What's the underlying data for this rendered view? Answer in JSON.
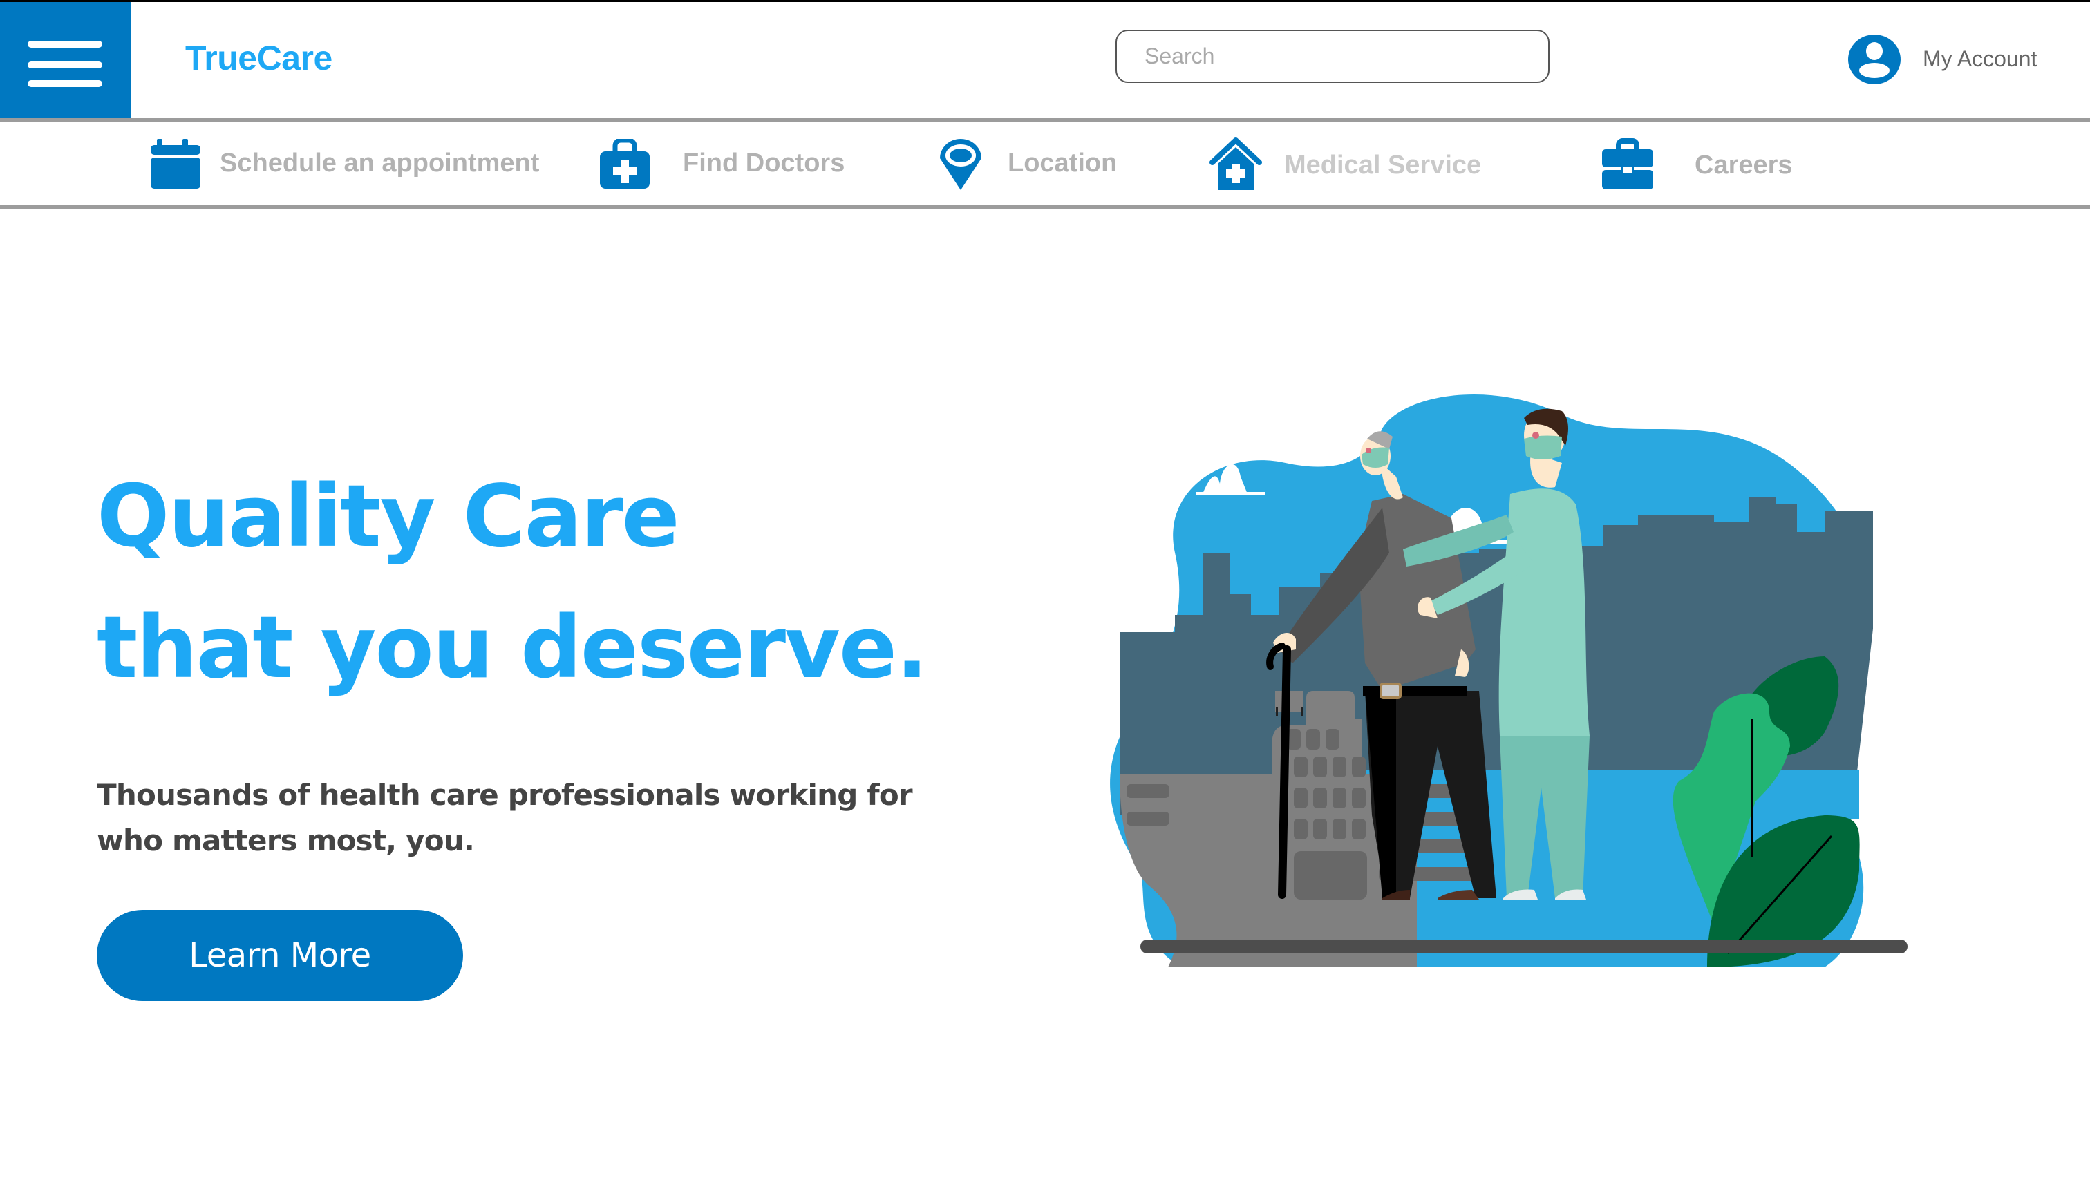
{
  "header": {
    "menu_icon": "hamburger-menu-icon",
    "brand": "TrueCare",
    "search": {
      "placeholder": "Search",
      "value": ""
    },
    "account": {
      "icon": "user-circle-icon",
      "label": "My Account"
    }
  },
  "nav": {
    "items": [
      {
        "icon": "calendar-icon",
        "label": "Schedule an appointment"
      },
      {
        "icon": "medical-kit-icon",
        "label": "Find Doctors"
      },
      {
        "icon": "location-pin-icon",
        "label": "Location"
      },
      {
        "icon": "hospital-house-icon",
        "label": "Medical Service"
      },
      {
        "icon": "briefcase-icon",
        "label": "Careers"
      }
    ]
  },
  "hero": {
    "title_line1": "Quality Care",
    "title_line2": "that you deserve.",
    "subtitle": "Thousands of health care professionals working for who matters most, you.",
    "cta_label": "Learn More",
    "illustration": "nurse-helping-elderly-man-illustration"
  },
  "colors": {
    "primary": "#0078c1",
    "accent": "#1ea8f5",
    "nav_text": "#b2b2b2",
    "body_text": "#444444",
    "divider": "#9c9c9c"
  }
}
